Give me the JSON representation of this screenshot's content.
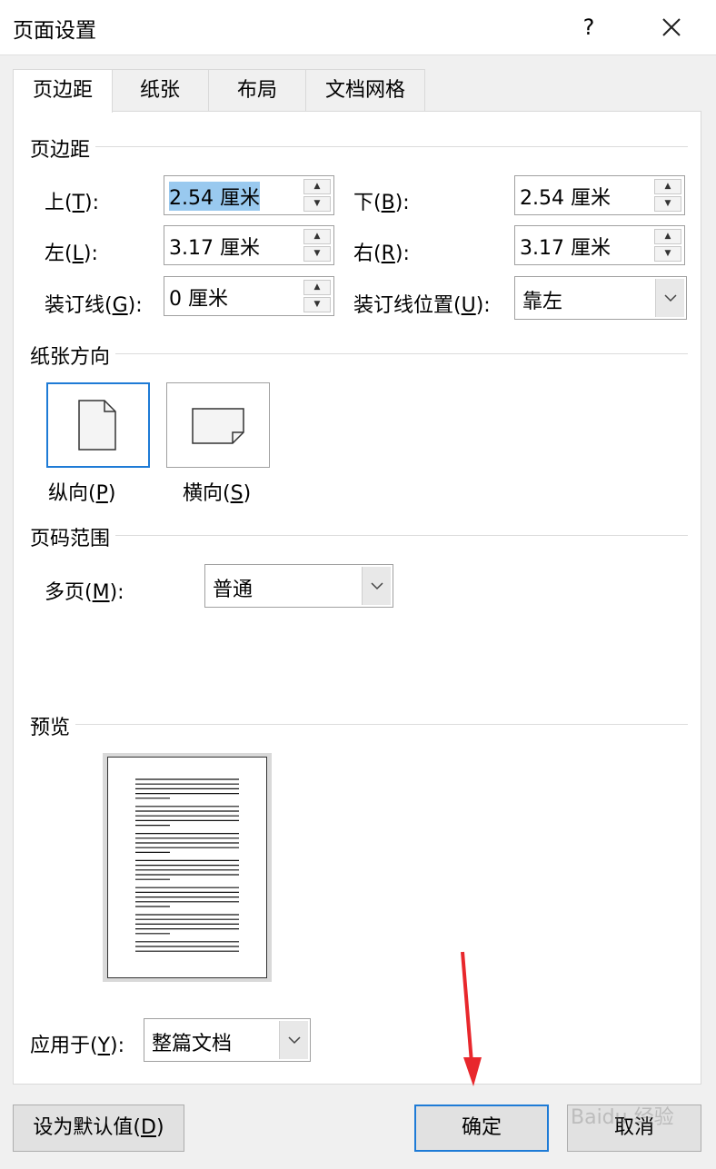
{
  "window": {
    "title": "页面设置",
    "help_label": "?"
  },
  "tabs": [
    {
      "label": "页边距",
      "active": true
    },
    {
      "label": "纸张",
      "active": false
    },
    {
      "label": "布局",
      "active": false
    },
    {
      "label": "文档网格",
      "active": false
    }
  ],
  "margins": {
    "group_title": "页边距",
    "top": {
      "label": "上(T):",
      "value": "2.54 厘米"
    },
    "bottom": {
      "label": "下(B):",
      "value": "2.54 厘米"
    },
    "left": {
      "label": "左(L):",
      "value": "3.17 厘米"
    },
    "right": {
      "label": "右(R):",
      "value": "3.17 厘米"
    },
    "gutter": {
      "label": "装订线(G):",
      "value": "0 厘米"
    },
    "gutter_pos": {
      "label": "装订线位置(U):",
      "value": "靠左"
    }
  },
  "orientation": {
    "group_title": "纸张方向",
    "portrait_label": "纵向(P)",
    "landscape_label": "横向(S)",
    "selected": "portrait"
  },
  "pages": {
    "group_title": "页码范围",
    "multi_label": "多页(M):",
    "multi_value": "普通"
  },
  "preview": {
    "group_title": "预览"
  },
  "apply": {
    "label": "应用于(Y):",
    "value": "整篇文档"
  },
  "buttons": {
    "default": "设为默认值(D)",
    "ok": "确定",
    "cancel": "取消"
  },
  "annotation": {
    "arrow_color": "#e8272c"
  },
  "colors": {
    "accent": "#1e7bd6",
    "selection": "#99c9ef"
  },
  "watermark": {
    "text": "Baidu 经验"
  }
}
